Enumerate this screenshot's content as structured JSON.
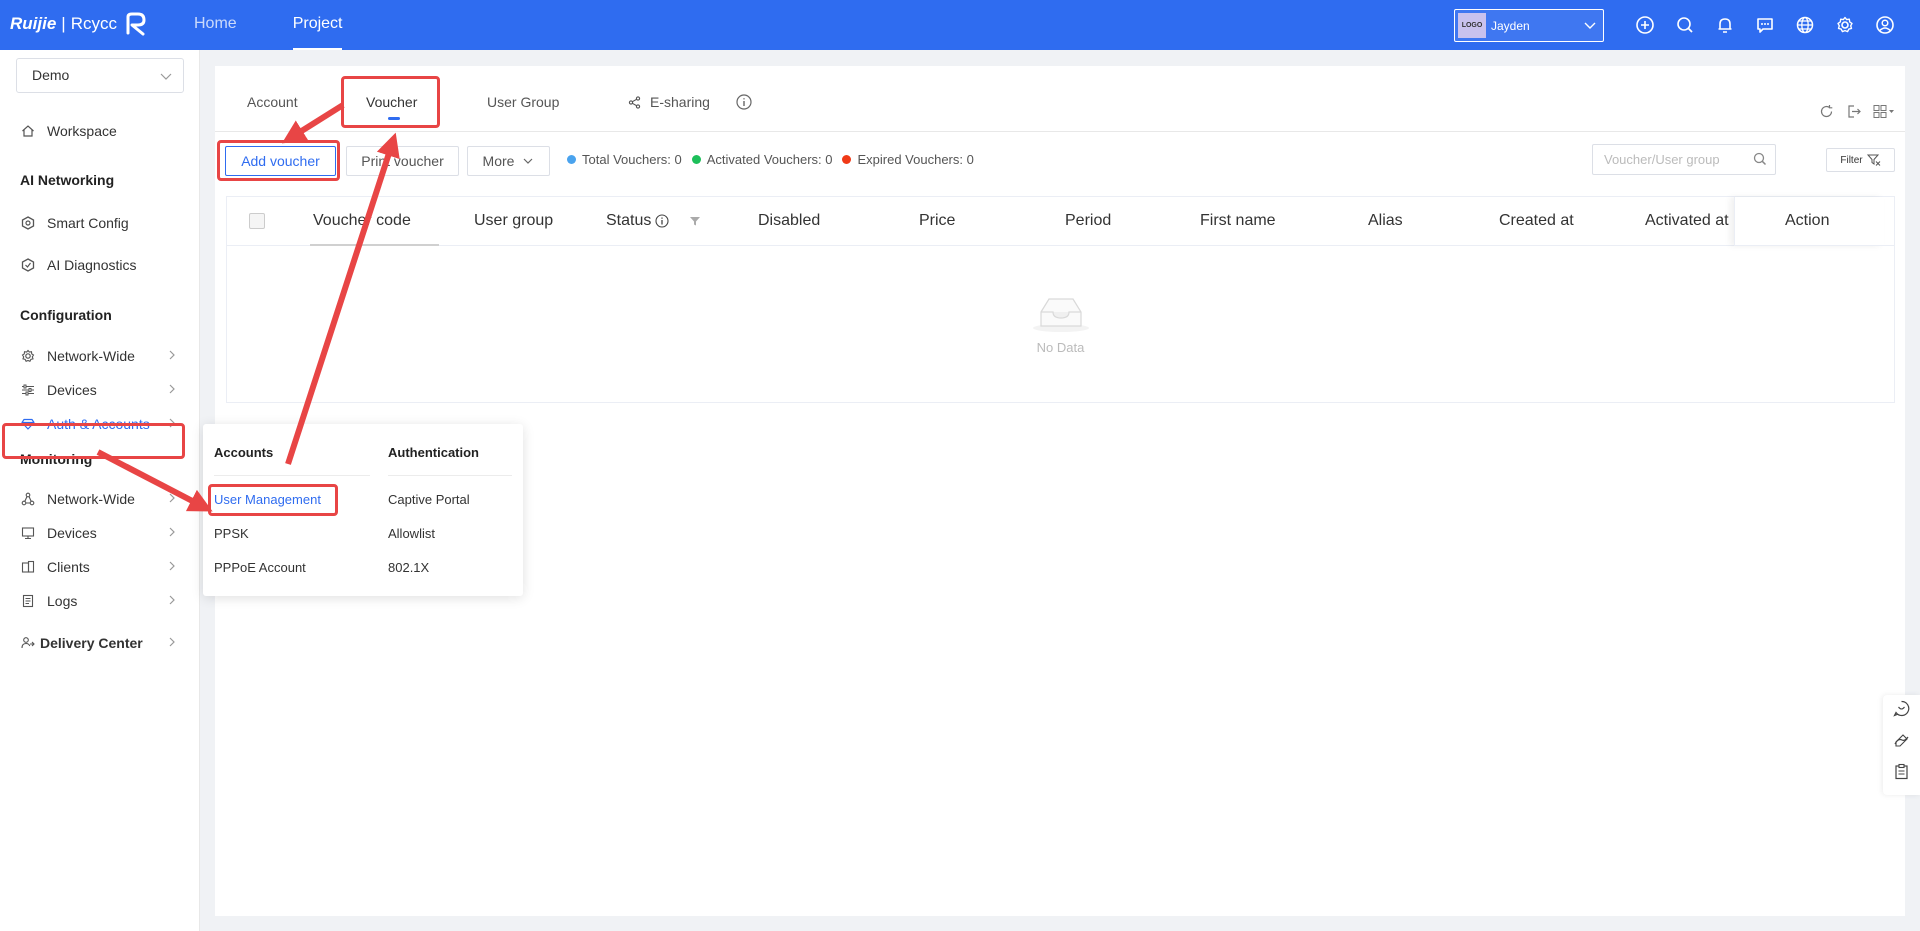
{
  "brand": {
    "name": "Ruijie",
    "sub": "Rcycc"
  },
  "topnav": [
    {
      "label": "Home"
    },
    {
      "label": "Project"
    }
  ],
  "account": {
    "logo": "LOGO",
    "name": "Jayden"
  },
  "top_icons": [
    "add-circle-icon",
    "search-icon",
    "bell-icon",
    "message-icon",
    "globe-icon",
    "gear-icon",
    "user-icon"
  ],
  "sidebar": {
    "project": "Demo",
    "workspace": "Workspace",
    "sections": {
      "ai": "AI Networking",
      "config": "Configuration",
      "monitoring": "Monitoring"
    },
    "items": {
      "smart_config": "Smart Config",
      "ai_diagnostics": "AI Diagnostics",
      "cfg_network": "Network-Wide",
      "cfg_devices": "Devices",
      "auth_accounts": "Auth & Accounts",
      "mon_network": "Network-Wide",
      "mon_devices": "Devices",
      "clients": "Clients",
      "logs": "Logs",
      "delivery": "Delivery Center"
    }
  },
  "tabs": {
    "account": "Account",
    "voucher": "Voucher",
    "user_group": "User Group",
    "esharing": "E-sharing"
  },
  "toolbar": {
    "add_voucher": "Add voucher",
    "print_voucher": "Print voucher",
    "more": "More",
    "stats": {
      "total": "Total Vouchers: 0",
      "activated": "Activated Vouchers: 0",
      "expired": "Expired Vouchers: 0"
    },
    "search_placeholder": "Voucher/User group",
    "filter": "Filter"
  },
  "table": {
    "columns": [
      "Voucher code",
      "User group",
      "Status",
      "Disabled",
      "Price",
      "Period",
      "First name",
      "Alias",
      "Created at",
      "Activated at",
      "Action"
    ],
    "empty": "No Data"
  },
  "popup": {
    "accounts_title": "Accounts",
    "auth_title": "Authentication",
    "accounts": [
      "User Management",
      "PPSK",
      "PPPoE Account"
    ],
    "auth": [
      "Captive Portal",
      "Allowlist",
      "802.1X"
    ]
  },
  "colors": {
    "primary": "#2f6cf0",
    "dot_total": "#4aa3ee",
    "dot_activated": "#1dbf5a",
    "dot_expired": "#f03a17",
    "annotation": "#e84545"
  }
}
